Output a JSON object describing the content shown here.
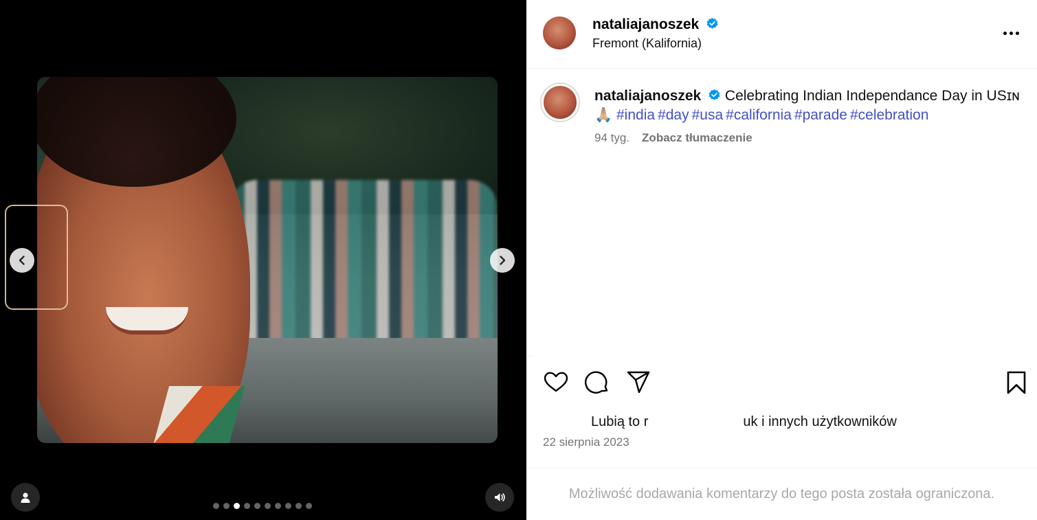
{
  "post": {
    "username": "nataliajanoszek",
    "location": "Fremont (Kalifornia)",
    "caption_text": "Celebrating Indian Independance Day in USɪɴ",
    "caption_emoji": "🙏🏼",
    "hashtags": [
      "#india",
      "#day",
      "#usa",
      "#california",
      "#parade",
      "#celebration"
    ],
    "time_ago": "94 tyg.",
    "translate_label": "Zobacz tłumaczenie",
    "likes_prefix": "Lubią to ",
    "likes_prefix_partial": "r",
    "likes_suffix": "uk i innych użytkowników",
    "date": "22 sierpnia 2023",
    "comments_disabled": "Możliwość dodawania komentarzy do tego posta została ograniczona."
  },
  "media": {
    "slide_count": 10,
    "active_slide": 3
  },
  "icons": {
    "prev": "chevron-left-icon",
    "next": "chevron-right-icon",
    "user": "user-icon",
    "sound": "speaker-icon",
    "like": "heart-icon",
    "comment": "comment-icon",
    "share": "send-icon",
    "save": "bookmark-icon",
    "verified": "verified-badge-icon",
    "more": "more-horizontal-icon"
  },
  "colors": {
    "verified": "#0095f6",
    "hashtag": "#4150c7",
    "muted": "#737373"
  }
}
